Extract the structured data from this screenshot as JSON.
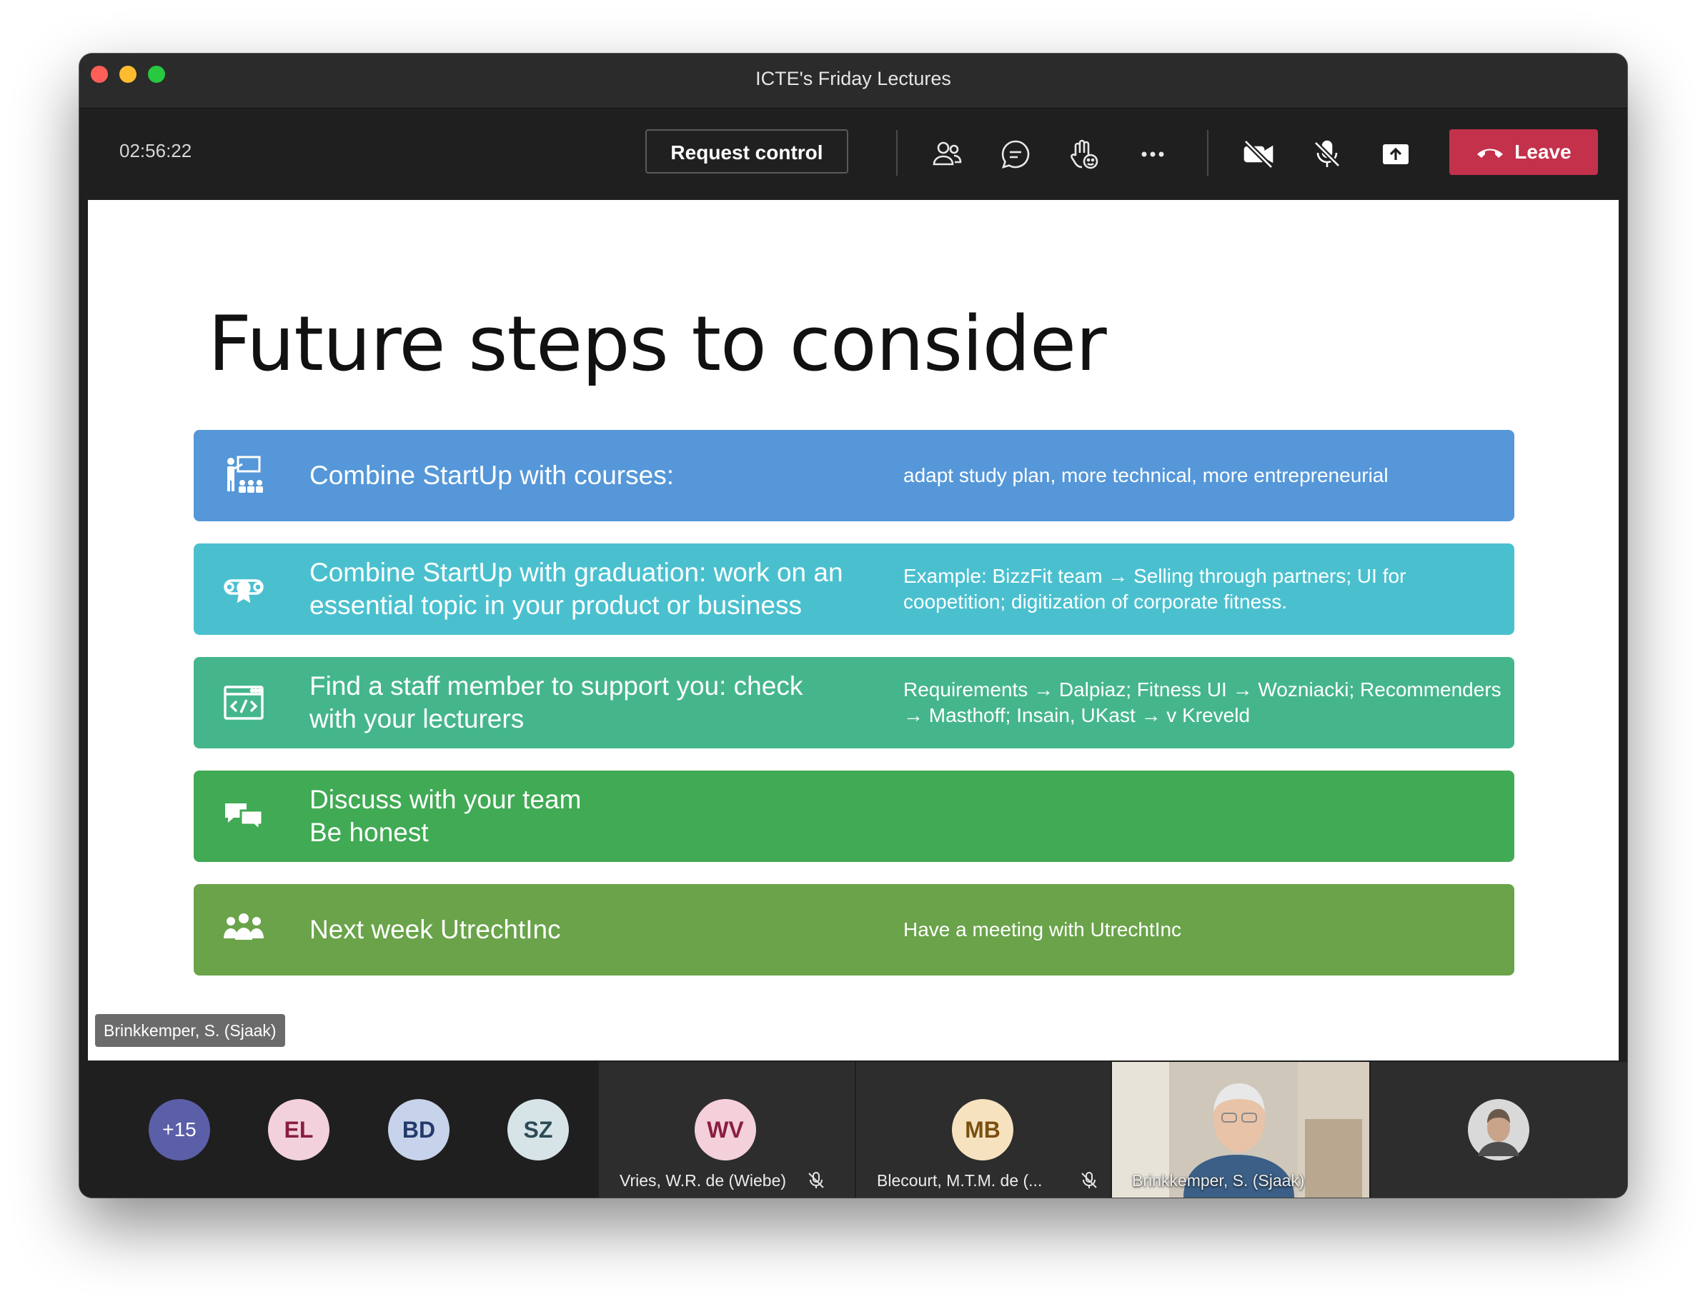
{
  "window": {
    "title": "ICTE's Friday Lectures"
  },
  "toolbar": {
    "timer": "02:56:22",
    "request_control": "Request control",
    "leave": "Leave",
    "icons": [
      "people-icon",
      "chat-icon",
      "raise-hand-icon",
      "more-icon",
      "camera-off-icon",
      "mic-off-icon",
      "share-icon"
    ]
  },
  "slide": {
    "title": "Future steps to consider",
    "rows": [
      {
        "icon": "teacher-icon",
        "color": "#5597d8",
        "main": [
          "Combine StartUp with courses:"
        ],
        "detail": [
          "adapt study plan, more technical, more entrepreneurial"
        ]
      },
      {
        "icon": "certificate-icon",
        "color": "#4ac0cf",
        "main": [
          "Combine StartUp with graduation: work on an",
          "essential topic in your product or business"
        ],
        "detail": [
          "Example: BizzFit team → Selling through partners; UI for",
          "coopetition; digitization of corporate fitness."
        ]
      },
      {
        "icon": "code-window-icon",
        "color": "#45b68c",
        "main": [
          "Find a staff member to support you: check",
          "with your lecturers"
        ],
        "detail": [
          "Requirements → Dalpiaz; Fitness UI → Wozniacki; Recommenders",
          "→ Masthoff; Insain, UKast → v Kreveld"
        ]
      },
      {
        "icon": "conversation-icon",
        "color": "#40aa54",
        "main": [
          "Discuss with your team",
          "Be honest"
        ],
        "detail": []
      },
      {
        "icon": "group-icon",
        "color": "#6aa34a",
        "main": [
          "Next week UtrechtInc"
        ],
        "detail": [
          "Have a meeting with UtrechtInc"
        ]
      }
    ]
  },
  "presenter_tag": "Brinkkemper, S. (Sjaak)",
  "participants": {
    "overflow": "+15",
    "avatars": [
      {
        "initials": "EL",
        "bg": "#f3d1dc",
        "fg": "#8a1e42"
      },
      {
        "initials": "BD",
        "bg": "#c7d3ea",
        "fg": "#233a6b"
      },
      {
        "initials": "SZ",
        "bg": "#d6e4e8",
        "fg": "#2b4a55"
      }
    ],
    "tiles": [
      {
        "initials": "WV",
        "name": "Vries, W.R. de (Wiebe)",
        "bg": "#f4d0da",
        "fg": "#8a1e42"
      },
      {
        "initials": "MB",
        "name": "Blecourt, M.T.M. de (...",
        "bg": "#f7e2c0",
        "fg": "#7a5012"
      },
      {
        "name": "Brinkkemper, S. (Sjaak)"
      }
    ]
  }
}
